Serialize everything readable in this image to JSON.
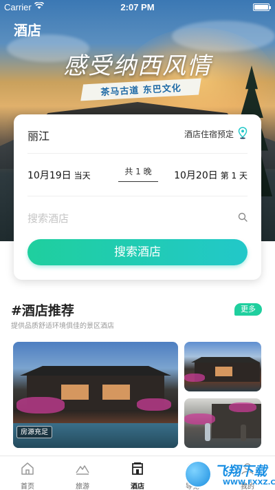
{
  "status_bar": {
    "carrier": "Carrier",
    "time": "2:07 PM"
  },
  "header": {
    "title": "酒店"
  },
  "banner": {
    "slogan": "感受纳西风情",
    "ribbon": "茶马古道  东巴文化"
  },
  "search_card": {
    "city": "丽江",
    "stay_type": "酒店住宿预定",
    "check_in": {
      "date": "10月19日",
      "label": "当天"
    },
    "nights": "共 1 晚",
    "check_out": {
      "date": "10月20日",
      "label": "第 1 天"
    },
    "search_placeholder": "搜索酒店",
    "search_button": "搜索酒店"
  },
  "recommend": {
    "title": "#酒店推荐",
    "subtitle": "提供品质舒适环境俱佳的景区酒店",
    "more": "更多",
    "badge": "房源充足"
  },
  "tabbar": {
    "items": [
      {
        "label": "首页",
        "icon": "home-icon"
      },
      {
        "label": "旅游",
        "icon": "mountain-icon"
      },
      {
        "label": "酒店",
        "icon": "hotel-icon",
        "active": true
      },
      {
        "label": "导览",
        "icon": "guide-icon"
      },
      {
        "label": "我的",
        "icon": "profile-icon"
      }
    ]
  },
  "watermark": {
    "text": "飞翔下载",
    "url": "WWW.FXXZ.COM"
  },
  "colors": {
    "accent": "#1fcf9e",
    "accent_end": "#22c8c9",
    "text": "#222222",
    "placeholder": "#c4c4c4"
  }
}
